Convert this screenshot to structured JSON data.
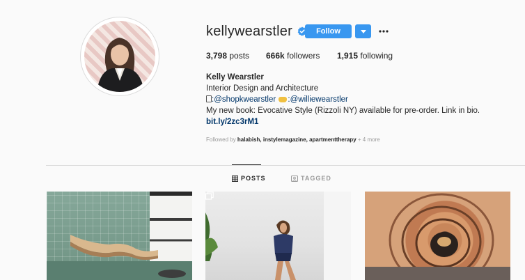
{
  "profile": {
    "username": "kellywearstler",
    "verified": true,
    "follow_label": "Follow",
    "stats": {
      "posts_count": "3,798",
      "posts_label": "posts",
      "followers_count": "666k",
      "followers_label": "followers",
      "following_count": "1,915",
      "following_label": "following"
    },
    "bio": {
      "name": "Kelly Wearstler",
      "category": "Interior Design and Architecture",
      "shop_handle": ":@shopkwearstler",
      "willie_handle": ":@williewearstler",
      "book_line": "My new book: Evocative Style (Rizzoli NY) available for pre-order. Link in bio.",
      "link": "bit.ly/2zc3rM1"
    },
    "followed_by": {
      "prefix": "Followed by",
      "names": "halabish, instylemagazine, apartmenttherapy",
      "more": "+ 4 more"
    }
  },
  "tabs": [
    {
      "label": "POSTS",
      "active": true
    },
    {
      "label": "TAGGED",
      "active": false
    }
  ],
  "icons": {
    "verified": "verified-badge-icon",
    "dropdown": "chevron-down-icon",
    "more": "more-options-icon",
    "posts_tab": "grid-icon",
    "tagged_tab": "tagged-icon",
    "multi_post": "multiple-posts-icon"
  },
  "colors": {
    "accent": "#3897f0",
    "link": "#003569",
    "muted": "#999999",
    "text": "#262626"
  }
}
